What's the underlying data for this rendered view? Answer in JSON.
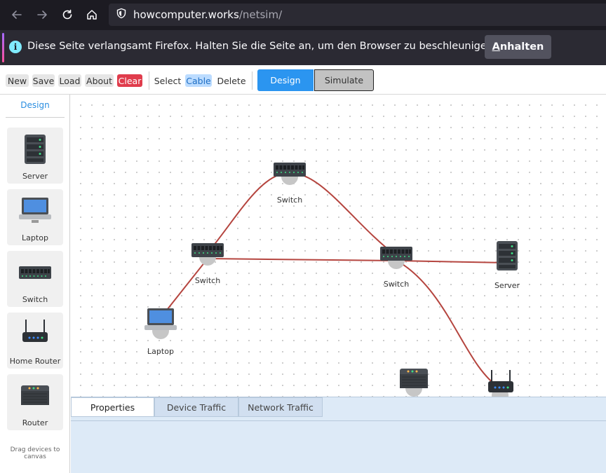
{
  "browser": {
    "url_host": "howcomputer.works",
    "url_path": "/netsim/",
    "notification": {
      "message": "Diese Seite verlangsamt Firefox. Halten Sie die Seite an, um den Browser zu beschleunigen.",
      "button_prefix": "A",
      "button_rest": "nhalten"
    }
  },
  "toolbar": {
    "new": "New",
    "save": "Save",
    "load": "Load",
    "about": "About",
    "clear": "Clear",
    "select": "Select",
    "cable": "Cable",
    "delete": "Delete",
    "mode_design": "Design",
    "mode_simulate": "Simulate"
  },
  "sidebar": {
    "title": "Design",
    "items": [
      {
        "label": "Server",
        "icon": "server-icon"
      },
      {
        "label": "Laptop",
        "icon": "laptop-icon"
      },
      {
        "label": "Switch",
        "icon": "switch-icon"
      },
      {
        "label": "Home Router",
        "icon": "home-router-icon"
      },
      {
        "label": "Router",
        "icon": "router-icon"
      }
    ],
    "hint": "Drag devices to canvas"
  },
  "canvas": {
    "nodes": [
      {
        "label": "Switch",
        "type": "switch"
      },
      {
        "label": "Switch",
        "type": "switch"
      },
      {
        "label": "Switch",
        "type": "switch"
      },
      {
        "label": "Server",
        "type": "server"
      },
      {
        "label": "Laptop",
        "type": "laptop"
      },
      {
        "label": "",
        "type": "router"
      },
      {
        "label": "",
        "type": "home-router"
      }
    ],
    "cable_color": "#b5453f"
  },
  "panel": {
    "tabs": [
      "Properties",
      "Device Traffic",
      "Network Traffic"
    ],
    "active_tab": "Properties"
  }
}
